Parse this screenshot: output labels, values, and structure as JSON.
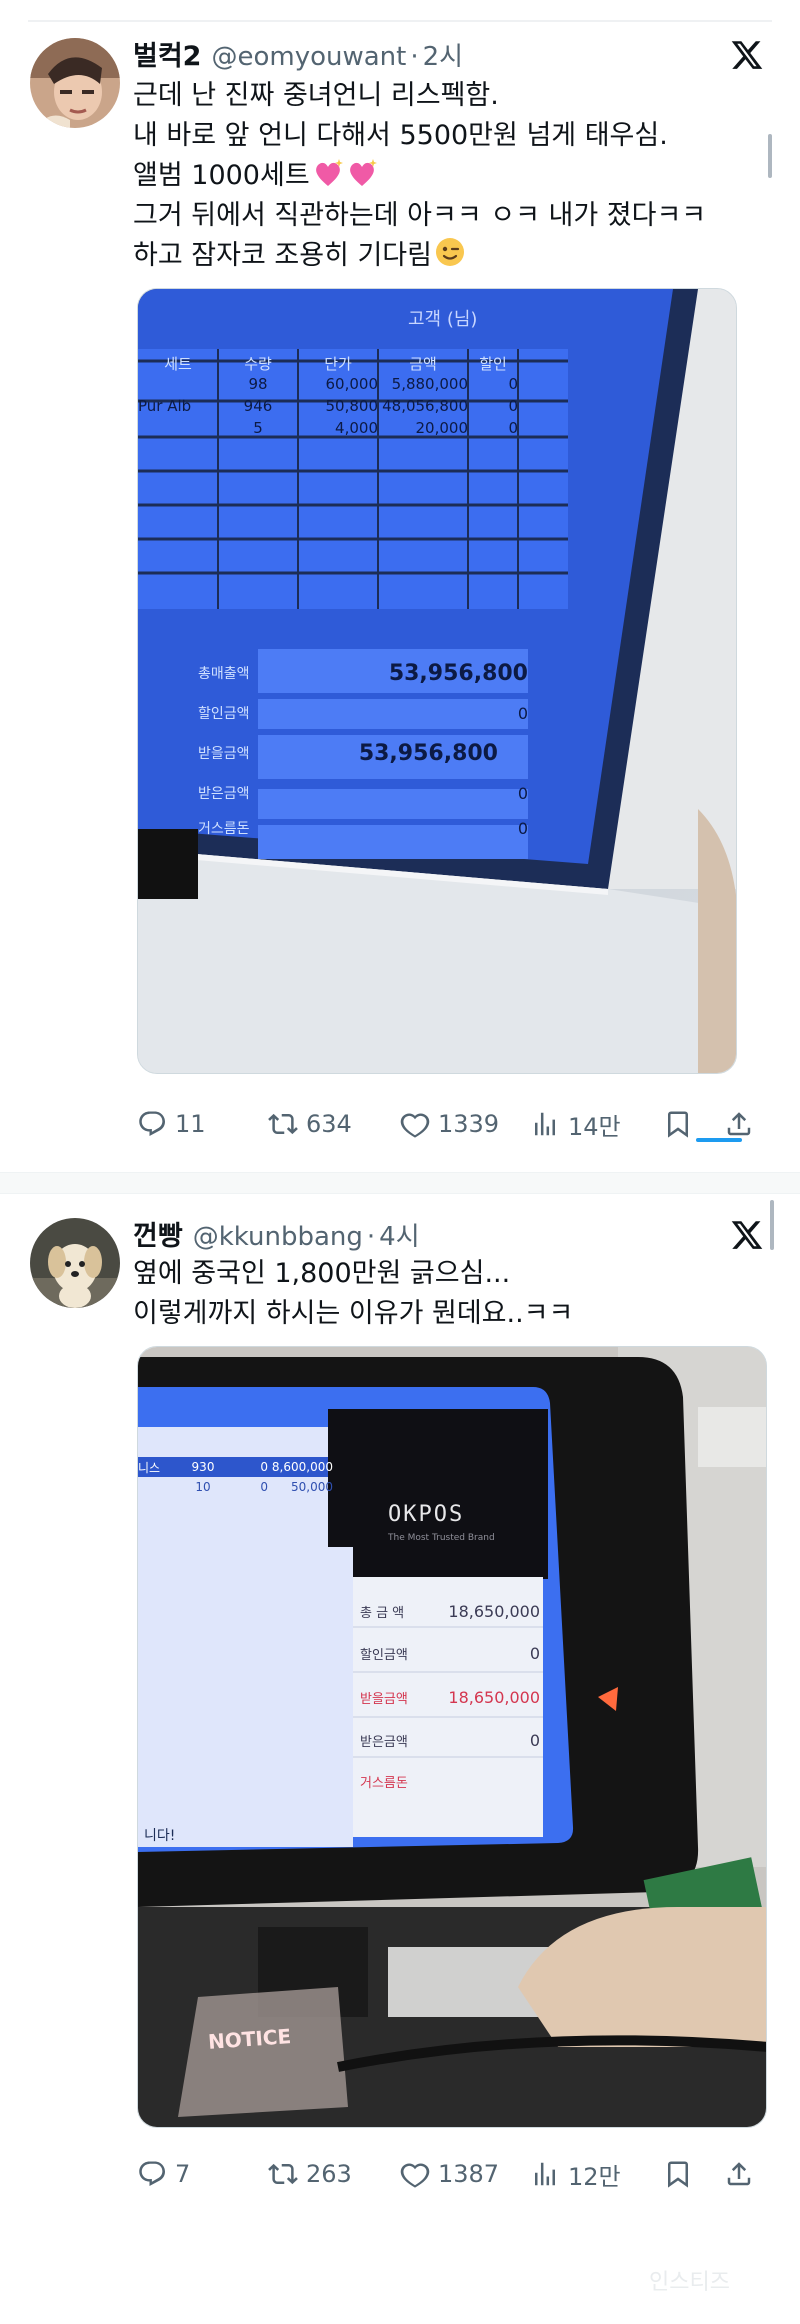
{
  "tweets": [
    {
      "display_name": "벌컥2",
      "handle": "@eomyouwant",
      "separator": "·",
      "time": "2시",
      "lines": [
        "근데 난 진짜 중녀언니 리스펙함.",
        "내 바로 앞 언니 다해서 5500만원 넘게 태우심.",
        "앨범 1000세트",
        "그거 뒤에서 직관하는데 아ㅋㅋ ㅇㅋ 내가 졌다ㅋㅋ",
        "하고 잠자코 조용히 기다림"
      ],
      "emoji": [
        "sparkling-hearts",
        "sparkling-hearts",
        "winking-face"
      ],
      "media": {
        "customer_label": "고객 (님)",
        "columns": [
          "세트",
          "수량",
          "단가",
          "금액",
          "할인"
        ],
        "rows": [
          [
            "",
            "98",
            "60,000",
            "5,880,000",
            "0"
          ],
          [
            "Pur Alb",
            "946",
            "50,800",
            "48,056,800",
            "0"
          ],
          [
            "",
            "5",
            "4,000",
            "20,000",
            "0"
          ]
        ],
        "totals": [
          {
            "label": "총매출액",
            "value": "53,956,800"
          },
          {
            "label": "할인금액",
            "value": "0"
          },
          {
            "label": "받을금액",
            "value": "53,956,800"
          },
          {
            "label": "받은금액",
            "value": "0"
          },
          {
            "label": "거스름돈",
            "value": "0"
          }
        ]
      },
      "stats": {
        "replies": "11",
        "retweets": "634",
        "likes": "1339",
        "views": "14만"
      }
    },
    {
      "display_name": "껀빵",
      "handle": "@kkunbbang",
      "separator": "·",
      "time": "4시",
      "lines": [
        "옆에 중국인 1,800만원 긁으심...",
        "이렇게까지 하시는 이유가 뭔데요..ㅋㅋ"
      ],
      "media": {
        "top_left_rows": [
          [
            "니스",
            "930",
            "0",
            "8,600,000"
          ],
          [
            "",
            "10",
            "0",
            "50,000"
          ]
        ],
        "brand": "OKPOS",
        "brand_sub": "The Most Trusted Brand",
        "totals": [
          {
            "label": "총 금 액",
            "value": "18,650,000"
          },
          {
            "label": "할인금액",
            "value": "0"
          },
          {
            "label": "받을금액",
            "value": "18,650,000"
          },
          {
            "label": "받은금액",
            "value": "0"
          },
          {
            "label": "거스름돈",
            "value": ""
          }
        ],
        "bottom_text": "니다!",
        "notice": "NOTICE"
      },
      "stats": {
        "replies": "7",
        "retweets": "263",
        "likes": "1387",
        "views": "12만"
      }
    }
  ],
  "watermark": "인스티즈",
  "colors": {
    "text": "#0f1419",
    "muted": "#536471",
    "accent": "#1d9bf0",
    "pos_blue": "#2d63e6"
  }
}
